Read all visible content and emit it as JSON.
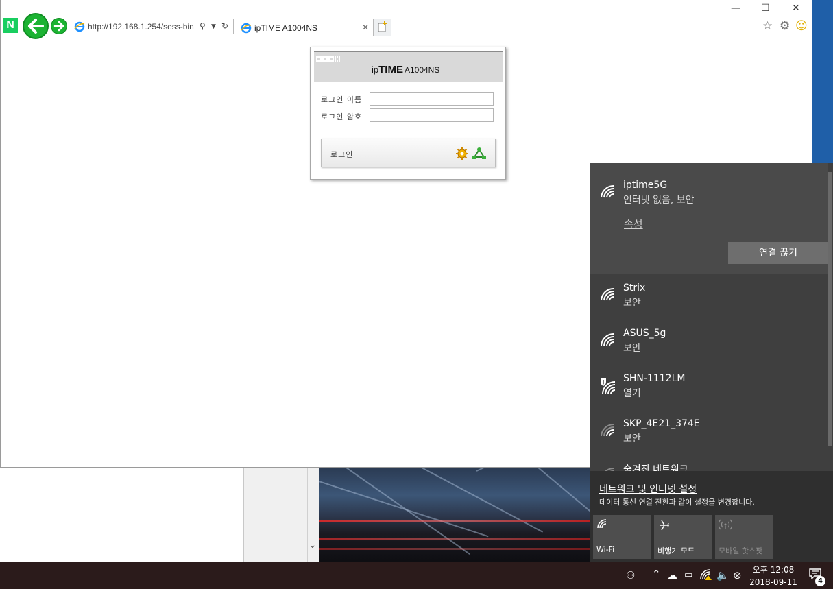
{
  "browser": {
    "address_url": "http://192.168.1.254/sess-bin",
    "tab_title": "ipTIME A1004NS",
    "tab_close": "✕",
    "window_minimize": "—",
    "window_maximize": "☐",
    "window_close": "✕"
  },
  "login": {
    "brand_prefix": "ip",
    "brand_strong": "TIME",
    "brand_model": "A1004NS",
    "username_label": "로그인 이름",
    "password_label": "로그인 암호",
    "username_value": "",
    "password_value": "",
    "login_button": "로그인"
  },
  "flyout": {
    "active_network": {
      "name": "iptime5G",
      "status": "인터넷 없음, 보안",
      "properties_link": "속성",
      "disconnect_button": "연결 끊기"
    },
    "networks": [
      {
        "name": "Strix",
        "status": "보안"
      },
      {
        "name": "ASUS_5g",
        "status": "보안"
      },
      {
        "name": "SHN-1112LM",
        "status": "열기"
      },
      {
        "name": "SKP_4E21_374E",
        "status": "보안"
      },
      {
        "name": "숨겨진 네트워크",
        "status": ""
      }
    ],
    "settings_link": "네트워크 및 인터넷 설정",
    "settings_desc": "데이터 통신 연결 전환과 같이 설정을 변경합니다.",
    "quick_actions": [
      {
        "label": "Wi-Fi",
        "icon": "wifi-icon",
        "state": "on"
      },
      {
        "label": "비행기 모드",
        "icon": "airplane-icon",
        "state": "on"
      },
      {
        "label": "모바일 핫스팟",
        "icon": "hotspot-icon",
        "state": "off"
      }
    ]
  },
  "taskbar": {
    "time": "오후 12:08",
    "date": "2018-09-11",
    "notification_count": "4"
  },
  "colors": {
    "accent_green": "#1cb333",
    "flyout_bg": "#3f3f3f",
    "taskbar_bg": "#2b1b1b"
  }
}
